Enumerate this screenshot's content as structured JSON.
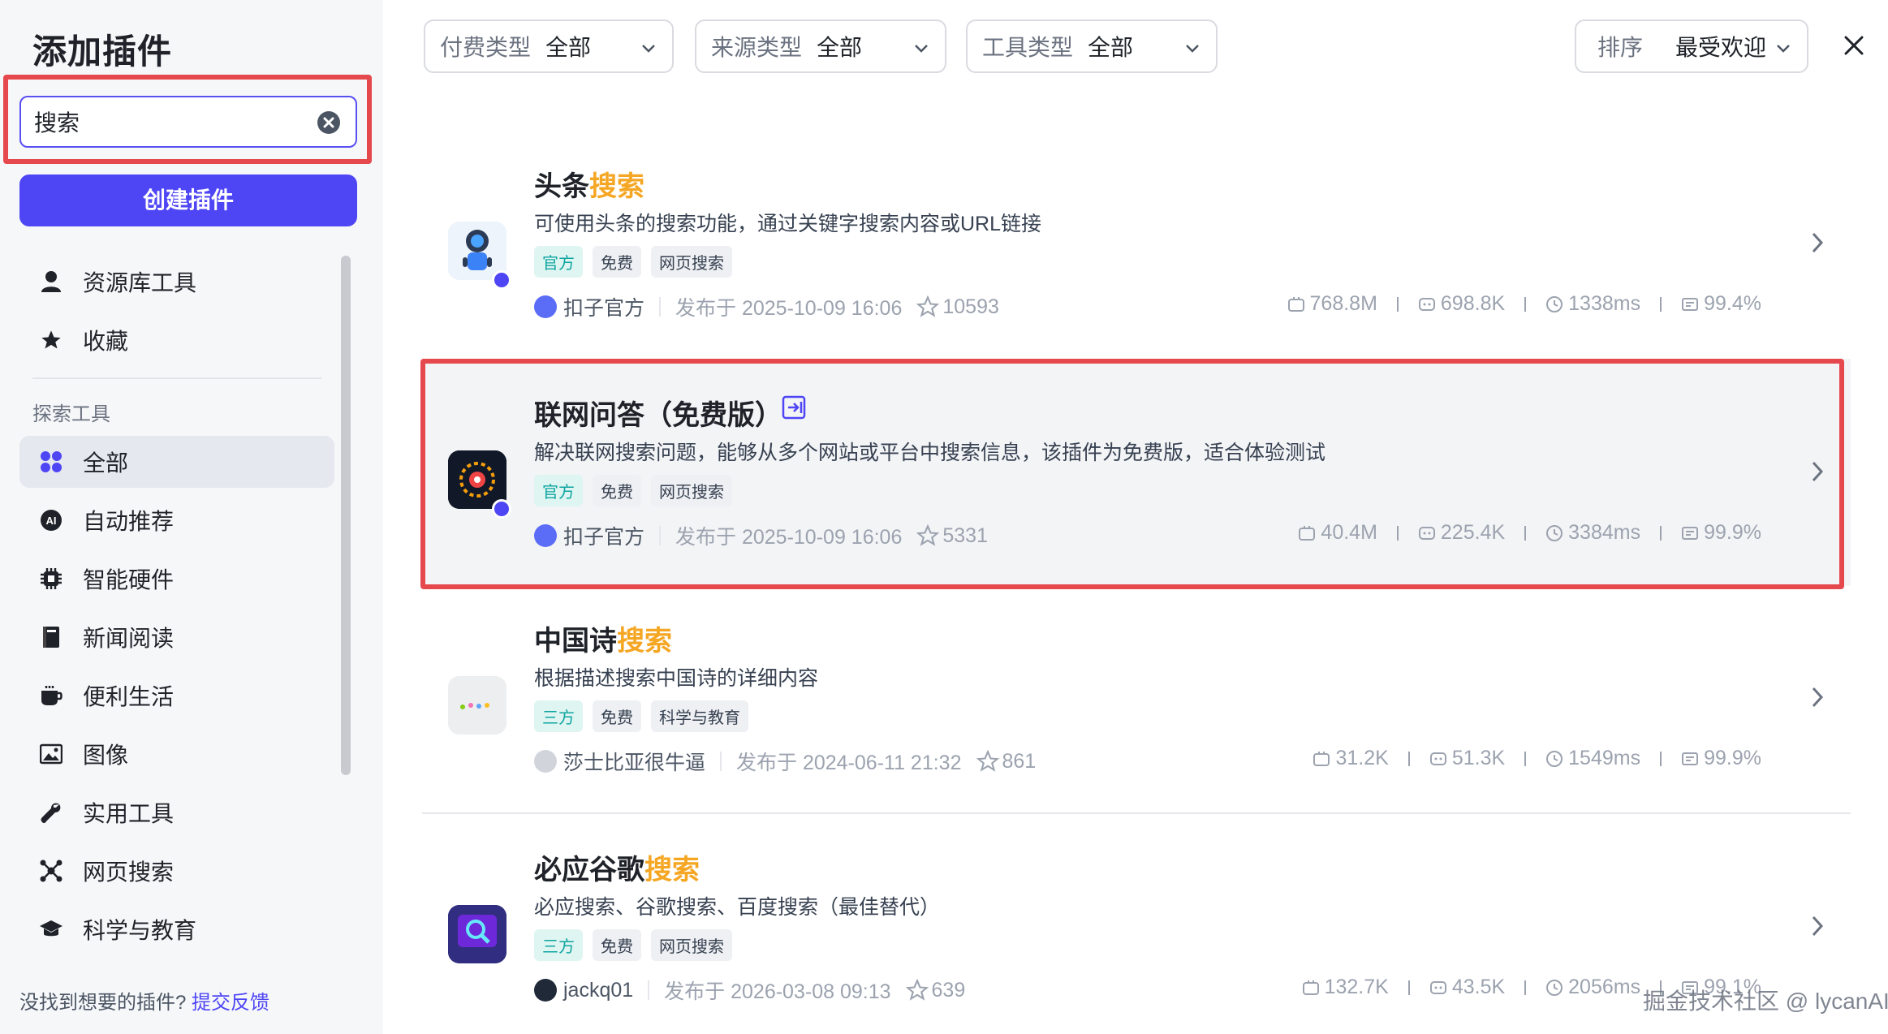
{
  "sidebar": {
    "title": "添加插件",
    "search": {
      "value": "搜索",
      "placeholder": ""
    },
    "create_label": "创建插件",
    "items_top": [
      {
        "label": "资源库工具",
        "icon": "user-icon"
      },
      {
        "label": "收藏",
        "icon": "star-icon"
      }
    ],
    "section_label": "探索工具",
    "items": [
      {
        "label": "全部",
        "icon": "grid-icon",
        "active": true
      },
      {
        "label": "自动推荐",
        "icon": "ai-icon"
      },
      {
        "label": "智能硬件",
        "icon": "chip-icon"
      },
      {
        "label": "新闻阅读",
        "icon": "book-icon"
      },
      {
        "label": "便利生活",
        "icon": "cup-icon"
      },
      {
        "label": "图像",
        "icon": "image-icon"
      },
      {
        "label": "实用工具",
        "icon": "wrench-icon"
      },
      {
        "label": "网页搜索",
        "icon": "network-icon"
      },
      {
        "label": "科学与教育",
        "icon": "graduation-cap-icon"
      }
    ],
    "feedback_text": "没找到想要的插件?",
    "feedback_link": "提交反馈"
  },
  "filters": [
    {
      "key": "付费类型",
      "value": "全部"
    },
    {
      "key": "来源类型",
      "value": "全部"
    },
    {
      "key": "工具类型",
      "value": "全部"
    }
  ],
  "sort": {
    "key": "排序",
    "value": "最受欢迎"
  },
  "plugins": [
    {
      "name_prefix": "头条",
      "name_hit": "搜索",
      "name_suffix": "",
      "desc": "可使用头条的搜索功能，通过关键字搜索内容或URL链接",
      "tags": [
        "官方",
        "免费",
        "网页搜索"
      ],
      "author": "扣子官方",
      "published": "发布于 2025-10-09 16:06",
      "stars": "10593",
      "stats": [
        "768.8M",
        "698.8K",
        "1338ms",
        "99.4%"
      ]
    },
    {
      "name_prefix": "联网问答（免费版）",
      "name_hit": "",
      "name_suffix": "",
      "desc": "解决联网搜索问题，能够从多个网站或平台中搜索信息，该插件为免费版，适合体验测试",
      "tags": [
        "官方",
        "免费",
        "网页搜索"
      ],
      "author": "扣子官方",
      "published": "发布于 2025-10-09 16:06",
      "stars": "5331",
      "stats": [
        "40.4M",
        "225.4K",
        "3384ms",
        "99.9%"
      ]
    },
    {
      "name_prefix": "中国诗",
      "name_hit": "搜索",
      "name_suffix": "",
      "desc": "根据描述搜索中国诗的详细内容",
      "tags": [
        "三方",
        "免费",
        "科学与教育"
      ],
      "author": "莎士比亚很牛逼",
      "published": "发布于 2024-06-11 21:32",
      "stars": "861",
      "stats": [
        "31.2K",
        "51.3K",
        "1549ms",
        "99.9%"
      ]
    },
    {
      "name_prefix": "必应谷歌",
      "name_hit": "搜索",
      "name_suffix": "",
      "desc": "必应搜索、谷歌搜索、百度搜索（最佳替代）",
      "tags": [
        "三方",
        "免费",
        "网页搜索"
      ],
      "author": "jackq01",
      "published": "发布于 2026-03-08 09:13",
      "stars": "639",
      "stats": [
        "132.7K",
        "43.5K",
        "2056ms",
        "99.1%"
      ]
    }
  ],
  "watermark": "掘金技术社区 @ lycanAI",
  "colors": {
    "accent": "#4e45f5",
    "highlight": "#e5484d",
    "hit": "#f5a623",
    "tag_teal": "#0ea5a0"
  }
}
